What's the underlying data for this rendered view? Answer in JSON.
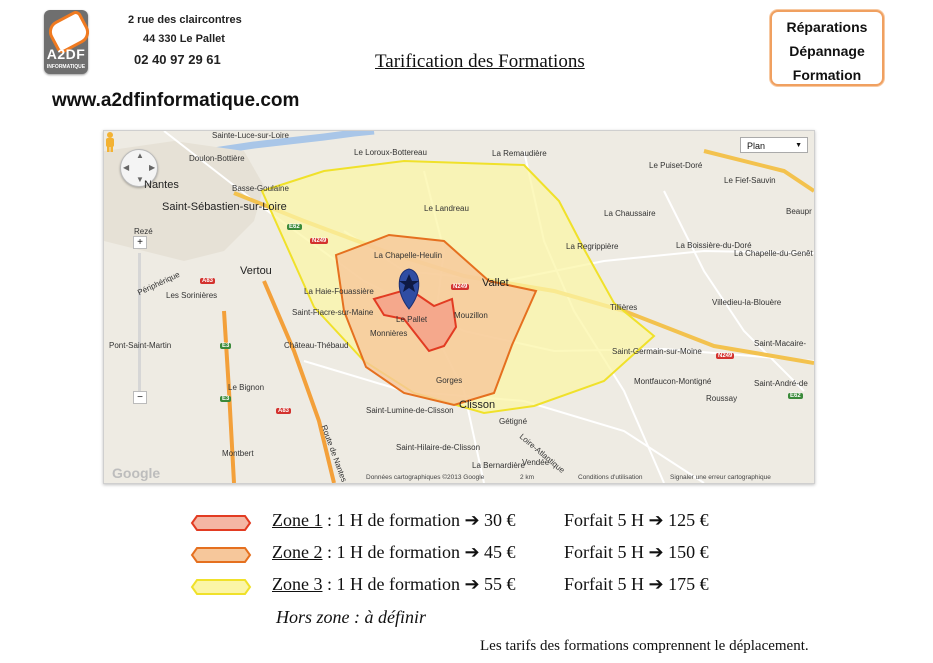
{
  "header": {
    "logo": {
      "text": "A2DF",
      "subtext": "INFORMATIQUE",
      "color": "#6f6f6f",
      "accent": "#f07a20"
    },
    "address_line1": "2 rue des claircontres",
    "address_line2": "44 330 Le Pallet",
    "phone": "02 40 97 29 61",
    "website": "www.a2dfinformatique.com",
    "title": "Tarification des Formations",
    "services": [
      "Réparations",
      "Dépannage",
      "Formation"
    ]
  },
  "map": {
    "type_selector": "Plan",
    "attribution": "Données cartographiques ©2013 Google",
    "scale": "2 km",
    "terms": "Conditions d'utilisation",
    "report": "Signaler une erreur cartographique",
    "google": "Google",
    "marker_icon": "star-marker-icon",
    "places": {
      "nantes": "Nantes",
      "st_sebastien": "Saint-Sébastien-sur-Loire",
      "reze": "Rezé",
      "vertou": "Vertou",
      "basse_goulaine": "Basse-Goulaine",
      "doulon": "Doulon-Bottière",
      "st_luce": "Sainte-Luce-sur-Loire",
      "loroux": "Le Loroux-Bottereau",
      "remaudiere": "La Remaudière",
      "puiset": "Le Puiset-Doré",
      "fief_sauvin": "Le Fief-Sauvin",
      "landreau": "Le Landreau",
      "chaussaire": "La Chaussaire",
      "beaupr": "Beaupr",
      "regrippiere": "La Regrippière",
      "boissiere": "La Boissière-du-Doré",
      "chapelle_genet": "La Chapelle-du-Genêt",
      "chapelle_heulin": "La Chapelle-Heulin",
      "vallet": "Vallet",
      "haie": "La Haie-Fouassière",
      "st_fiacre": "Saint-Fiacre-sur-Maine",
      "le_pallet": "Le Pallet",
      "monnieres": "Monnières",
      "mouzillon": "Mouzillon",
      "tillieres": "Tillières",
      "villedieu": "Villedieu-la-Blouère",
      "sorinieres": "Les Sorinières",
      "st_martin": "Pont-Saint-Martin",
      "chateau_thebaud": "Château-Thébaud",
      "gorges": "Gorges",
      "st_germain": "Saint-Germain-sur-Moine",
      "st_macaire": "Saint-Macaire-",
      "montfaucon": "Montfaucon-Montigné",
      "st_andre": "Saint-André-de",
      "roussay": "Roussay",
      "bignon": "Le Bignon",
      "clisson": "Clisson",
      "st_lumine": "Saint-Lumine-de-Clisson",
      "getigne": "Gétigné",
      "montbert": "Montbert",
      "hilaire": "Saint-Hilaire-de-Clisson",
      "bernardiere": "La Bernardière",
      "peripherique": "Périphérique",
      "loire_atlantique": "Loire-Atlantique",
      "vendee": "Vendée",
      "route_nantes": "Route de Nantes"
    },
    "roads": {
      "n249a": "N249",
      "n249b": "N249",
      "n249c": "N249",
      "e62a": "E62",
      "e62b": "E62",
      "a83a": "A83",
      "a83b": "A83",
      "e3a": "E3",
      "e3b": "E3"
    }
  },
  "legend": [
    {
      "zone": "Zone 1",
      "text": " : 1 H de formation ➔ 30 €",
      "forfait": "Forfait 5 H ➔ 125 €",
      "fill": "#f4b6a4",
      "stroke": "#e23b22"
    },
    {
      "zone": "Zone 2",
      "text": " : 1 H de formation ➔ 45 €",
      "forfait": "Forfait 5 H ➔ 150 €",
      "fill": "#f6c79b",
      "stroke": "#e5701f"
    },
    {
      "zone": "Zone 3",
      "text": " : 1 H de formation ➔ 55 €",
      "forfait": "Forfait 5 H ➔ 175 €",
      "fill": "#fbf5a7",
      "stroke": "#f0e12a"
    }
  ],
  "hors_zone": "Hors zone : à définir",
  "footer": "Les tarifs des formations comprennent le déplacement."
}
